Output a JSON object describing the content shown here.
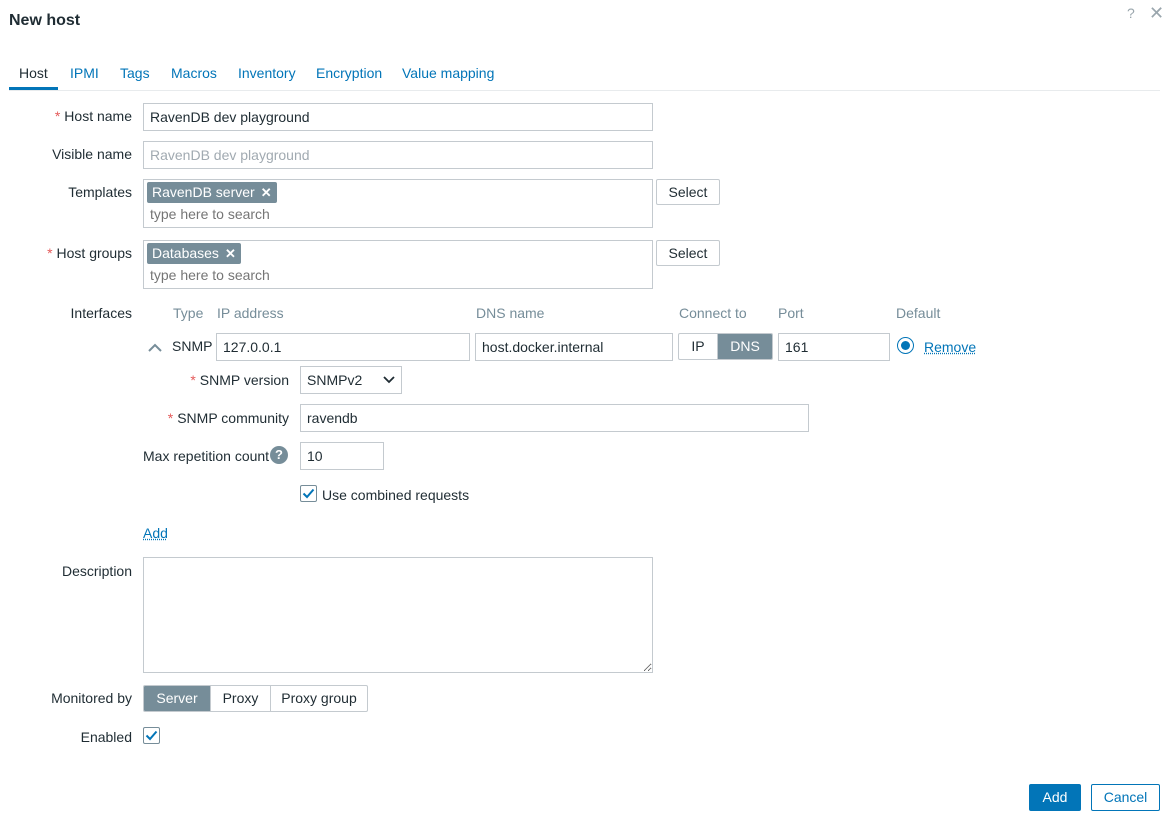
{
  "dialog": {
    "title": "New host",
    "help": "?",
    "close": "✕"
  },
  "tabs": [
    {
      "label": "Host",
      "active": true
    },
    {
      "label": "IPMI"
    },
    {
      "label": "Tags"
    },
    {
      "label": "Macros"
    },
    {
      "label": "Inventory"
    },
    {
      "label": "Encryption"
    },
    {
      "label": "Value mapping"
    }
  ],
  "form": {
    "host_name": {
      "label": "Host name",
      "value": "RavenDB dev playground"
    },
    "visible_name": {
      "label": "Visible name",
      "placeholder": "RavenDB dev playground"
    },
    "templates": {
      "label": "Templates",
      "chip": "RavenDB server",
      "placeholder": "type here to search",
      "select_label": "Select"
    },
    "host_groups": {
      "label": "Host groups",
      "chip": "Databases",
      "placeholder": "type here to search",
      "select_label": "Select"
    },
    "interfaces": {
      "label": "Interfaces",
      "columns": {
        "type": "Type",
        "ip": "IP address",
        "dns": "DNS name",
        "connect": "Connect to",
        "port": "Port",
        "default": "Default"
      },
      "row": {
        "type": "SNMP",
        "ip": "127.0.0.1",
        "dns": "host.docker.internal",
        "connect_ip": "IP",
        "connect_dns": "DNS",
        "connect_selected": "DNS",
        "port": "161",
        "remove": "Remove"
      },
      "snmp_version": {
        "label": "SNMP version",
        "value": "SNMPv2"
      },
      "snmp_community": {
        "label": "SNMP community",
        "value": "ravendb"
      },
      "max_repetition": {
        "label": "Max repetition count",
        "value": "10"
      },
      "combined": {
        "label": "Use combined requests",
        "checked": true
      },
      "add": "Add"
    },
    "description": {
      "label": "Description",
      "value": ""
    },
    "monitored_by": {
      "label": "Monitored by",
      "options": [
        "Server",
        "Proxy",
        "Proxy group"
      ],
      "selected": "Server"
    },
    "enabled": {
      "label": "Enabled",
      "checked": true
    }
  },
  "footer": {
    "add": "Add",
    "cancel": "Cancel"
  },
  "colors": {
    "accent": "#0275b8",
    "chip": "#768d99",
    "required": "#e45959"
  }
}
